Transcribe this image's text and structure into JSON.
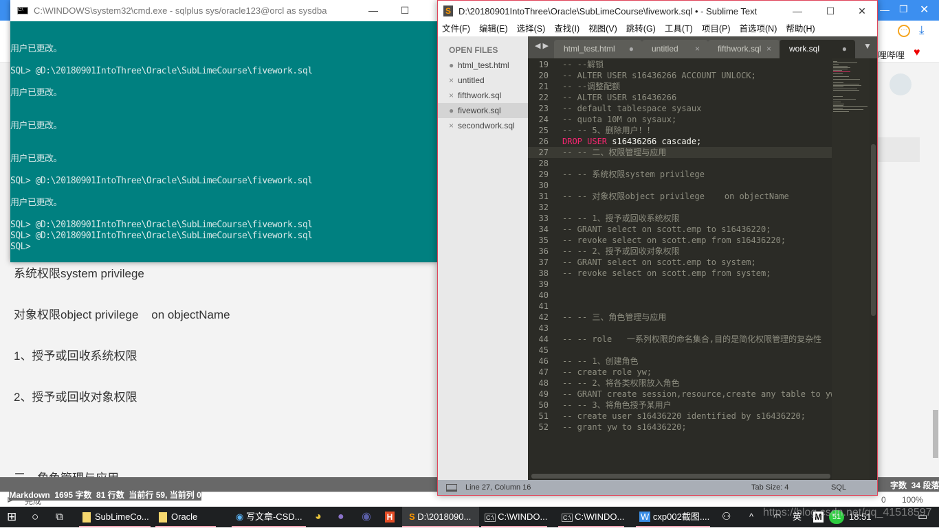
{
  "browser": {
    "right_link": "哩哔哩",
    "markdown_lines": [
      "系统权限system privilege",
      "对象权限object privilege    on objectName",
      "1、授予或回收系统权限",
      "2、授予或回收对象权限",
      "三、角色管理与应用"
    ],
    "md_status": "Markdown  1695 字数  81 行数  当前行 59, 当前列 0",
    "md_status_right": "字数  34 段落",
    "status_done": "完成",
    "status_count": "0",
    "zoom": "100%"
  },
  "cmd": {
    "title": "C:\\WINDOWS\\system32\\cmd.exe - sqlplus  sys/oracle123@orcl as sysdba",
    "lines": [
      "用户已更改。",
      "",
      "SQL> @D:\\20180901IntoThree\\Oracle\\SubLimeCourse\\fivework.sql",
      "",
      "用户已更改。",
      "",
      "",
      "用户已更改。",
      "",
      "",
      "用户已更改。",
      "",
      "SQL> @D:\\20180901IntoThree\\Oracle\\SubLimeCourse\\fivework.sql",
      "",
      "用户已更改。",
      "",
      "SQL> @D:\\20180901IntoThree\\Oracle\\SubLimeCourse\\fivework.sql",
      "SQL> @D:\\20180901IntoThree\\Oracle\\SubLimeCourse\\fivework.sql",
      "SQL>"
    ]
  },
  "sublime": {
    "title": "D:\\20180901IntoThree\\Oracle\\SubLimeCourse\\fivework.sql • - Sublime Text",
    "menu": [
      "文件(F)",
      "编辑(E)",
      "选择(S)",
      "查找(I)",
      "视图(V)",
      "跳转(G)",
      "工具(T)",
      "项目(P)",
      "首选项(N)",
      "帮助(H)"
    ],
    "open_files_label": "OPEN FILES",
    "files": [
      {
        "name": "html_test.html",
        "mark": "●"
      },
      {
        "name": "untitled",
        "mark": "×"
      },
      {
        "name": "fifthwork.sql",
        "mark": "×"
      },
      {
        "name": "fivework.sql",
        "mark": "●",
        "active": true
      },
      {
        "name": "secondwork.sql",
        "mark": "×"
      }
    ],
    "tabs": [
      {
        "label": "html_test.html",
        "mark": "●"
      },
      {
        "label": "untitled",
        "mark": "×"
      },
      {
        "label": "fifthwork.sql",
        "mark": "×"
      },
      {
        "label": "work.sql",
        "mark": "●"
      }
    ],
    "code": [
      {
        "n": "19",
        "t": "-- --解锁"
      },
      {
        "n": "20",
        "t": "-- ALTER USER s16436266 ACCOUNT UNLOCK;"
      },
      {
        "n": "21",
        "t": "-- --调整配额"
      },
      {
        "n": "22",
        "t": "-- ALTER USER s16436266"
      },
      {
        "n": "23",
        "t": "-- default tablespace sysaux"
      },
      {
        "n": "24",
        "t": "-- quota 10M on sysaux;"
      },
      {
        "n": "25",
        "t": "-- -- 5、删除用户！！"
      },
      {
        "n": "26",
        "kw": "DROP USER",
        "t": " s16436266 cascade;"
      },
      {
        "n": "27",
        "t": "-- -- 二、权限管理与应用"
      },
      {
        "n": "28",
        "t": ""
      },
      {
        "n": "29",
        "t": "-- -- 系统权限system privilege"
      },
      {
        "n": "30",
        "t": ""
      },
      {
        "n": "31",
        "t": "-- -- 对象权限object privilege    on objectName"
      },
      {
        "n": "32",
        "t": ""
      },
      {
        "n": "33",
        "t": "-- -- 1、授予或回收系统权限"
      },
      {
        "n": "34",
        "t": "-- GRANT select on scott.emp to s16436220;"
      },
      {
        "n": "35",
        "t": "-- revoke select on scott.emp from s16436220;"
      },
      {
        "n": "36",
        "t": "-- -- 2、授予或回收对象权限"
      },
      {
        "n": "37",
        "t": "-- GRANT select on scott.emp to system;"
      },
      {
        "n": "38",
        "t": "-- revoke select on scott.emp from system;"
      },
      {
        "n": "39",
        "t": ""
      },
      {
        "n": "40",
        "t": ""
      },
      {
        "n": "41",
        "t": ""
      },
      {
        "n": "42",
        "t": "-- -- 三、角色管理与应用"
      },
      {
        "n": "43",
        "t": ""
      },
      {
        "n": "44",
        "t": "-- -- role   一系列权限的命名集合,目的是简化权限管理的复杂性"
      },
      {
        "n": "45",
        "t": ""
      },
      {
        "n": "46",
        "t": "-- -- 1、创建角色"
      },
      {
        "n": "47",
        "t": "-- create role yw;"
      },
      {
        "n": "48",
        "t": "-- -- 2、将各类权限放入角色"
      },
      {
        "n": "49",
        "t": "-- GRANT create session,resource,create any table to yw"
      },
      {
        "n": "50",
        "t": "-- -- 3、将角色授予某用户"
      },
      {
        "n": "51",
        "t": "-- create user s16436220 identified by s16436220;"
      },
      {
        "n": "52",
        "t": "-- grant yw to s16436220;"
      }
    ],
    "current_line": "27",
    "status": {
      "position": "Line 27, Column 16",
      "tab_size": "Tab Size: 4",
      "syntax": "SQL"
    }
  },
  "taskbar": {
    "items": [
      "SubLimeCo...",
      "Oracle",
      "写文章-CSD...",
      "D:\\2018090...",
      "C:\\WINDO...",
      "C:\\WINDO...",
      "cxp002截图...."
    ],
    "ime": "英",
    "badge": "51",
    "time": "18:51",
    "watermark": "https://blog.csdn.net/qq_41518597"
  },
  "colors": {
    "cmd_bg": "#008080",
    "editor_bg": "#2b2b26",
    "keyword": "#f92672",
    "sublime_border": "#e0455a"
  }
}
